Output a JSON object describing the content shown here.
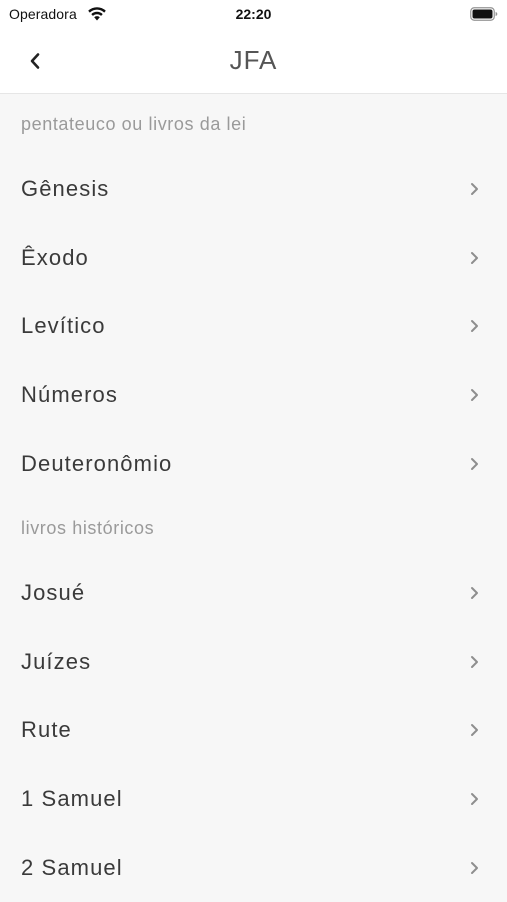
{
  "status_bar": {
    "carrier": "Operadora",
    "time": "22:20",
    "icons": [
      "wifi-icon",
      "battery-icon"
    ]
  },
  "nav": {
    "title": "JFA",
    "back_icon": "chevron-left-icon"
  },
  "sections": [
    {
      "header": "pentateuco ou livros da lei",
      "items": [
        {
          "label": "Gênesis"
        },
        {
          "label": "Êxodo"
        },
        {
          "label": "Levítico"
        },
        {
          "label": "Números"
        },
        {
          "label": "Deuteronômio"
        }
      ]
    },
    {
      "header": "livros históricos",
      "items": [
        {
          "label": "Josué"
        },
        {
          "label": "Juízes"
        },
        {
          "label": "Rute"
        },
        {
          "label": "1 Samuel"
        },
        {
          "label": "2 Samuel"
        }
      ]
    }
  ],
  "colors": {
    "background": "#f7f7f7",
    "bar_background": "#ffffff",
    "text": "#3a3a3a",
    "section_header": "#9a9a9a",
    "chevron": "#8e8e8e"
  }
}
